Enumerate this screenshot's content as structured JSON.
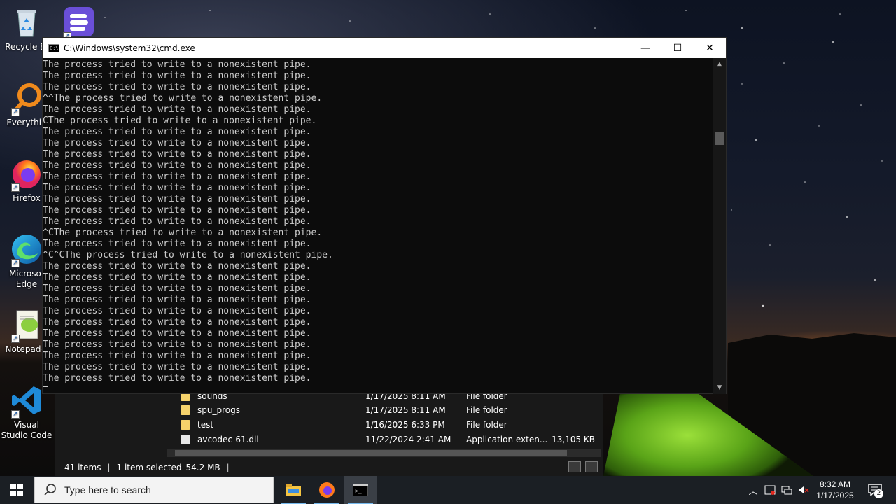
{
  "desktop": {
    "icons": [
      {
        "label": "Recycle Bi",
        "icon": "recycle-bin-icon"
      },
      {
        "label": "",
        "icon": "app-b-icon"
      },
      {
        "label": "Everythin",
        "icon": "everything-search-icon"
      },
      {
        "label": "Firefox",
        "icon": "firefox-icon"
      },
      {
        "label": "Microsof Edge",
        "icon": "edge-icon"
      },
      {
        "label": "Notepad+",
        "icon": "notepad-plus-plus-icon"
      },
      {
        "label": "Visual Studio Code",
        "icon": "vscode-icon"
      }
    ]
  },
  "cmd": {
    "title": "C:\\Windows\\system32\\cmd.exe",
    "minimize": "—",
    "maximize": "☐",
    "close": "✕",
    "lines": [
      "The process tried to write to a nonexistent pipe.",
      "The process tried to write to a nonexistent pipe.",
      "The process tried to write to a nonexistent pipe.",
      "^^The process tried to write to a nonexistent pipe.",
      "The process tried to write to a nonexistent pipe.",
      "CThe process tried to write to a nonexistent pipe.",
      "The process tried to write to a nonexistent pipe.",
      "The process tried to write to a nonexistent pipe.",
      "The process tried to write to a nonexistent pipe.",
      "The process tried to write to a nonexistent pipe.",
      "The process tried to write to a nonexistent pipe.",
      "The process tried to write to a nonexistent pipe.",
      "The process tried to write to a nonexistent pipe.",
      "The process tried to write to a nonexistent pipe.",
      "The process tried to write to a nonexistent pipe.",
      "^CThe process tried to write to a nonexistent pipe.",
      "The process tried to write to a nonexistent pipe.",
      "^C^CThe process tried to write to a nonexistent pipe.",
      "The process tried to write to a nonexistent pipe.",
      "The process tried to write to a nonexistent pipe.",
      "The process tried to write to a nonexistent pipe.",
      "The process tried to write to a nonexistent pipe.",
      "The process tried to write to a nonexistent pipe.",
      "The process tried to write to a nonexistent pipe.",
      "The process tried to write to a nonexistent pipe.",
      "The process tried to write to a nonexistent pipe.",
      "The process tried to write to a nonexistent pipe.",
      "The process tried to write to a nonexistent pipe.",
      "The process tried to write to a nonexistent pipe."
    ]
  },
  "explorer": {
    "rows": [
      {
        "name": "sounds",
        "date": "1/17/2025 8:11 AM",
        "type": "File folder",
        "size": "",
        "kind": "folder"
      },
      {
        "name": "spu_progs",
        "date": "1/17/2025 8:11 AM",
        "type": "File folder",
        "size": "",
        "kind": "folder"
      },
      {
        "name": "test",
        "date": "1/16/2025 6:33 PM",
        "type": "File folder",
        "size": "",
        "kind": "folder"
      },
      {
        "name": "avcodec-61.dll",
        "date": "11/22/2024 2:41 AM",
        "type": "Application exten...",
        "size": "13,105 KB",
        "kind": "file"
      }
    ],
    "status": {
      "items": "41 items",
      "selected": "1 item selected",
      "size": "54.2 MB"
    }
  },
  "taskbar": {
    "search_placeholder": "Type here to search",
    "apps": [
      "file-explorer-icon",
      "firefox-icon",
      "cmd-icon"
    ],
    "time": "8:32 AM",
    "date": "1/17/2025",
    "notifications": "2"
  }
}
